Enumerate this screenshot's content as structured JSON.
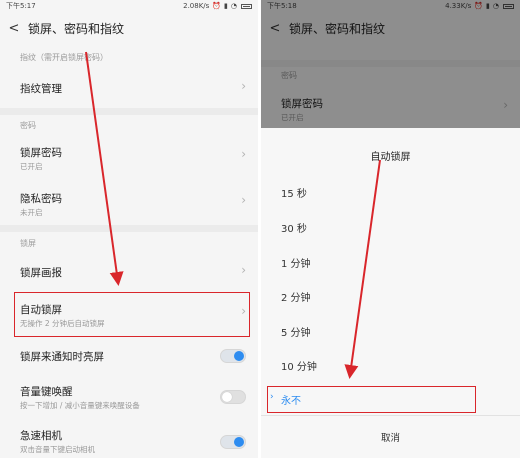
{
  "left": {
    "status": {
      "time": "下午5:17",
      "speed": "2.08K/s"
    },
    "title": "锁屏、密码和指纹",
    "fingerprint_section": "指纹（需开启锁屏密码）",
    "fingerprint_manage": "指纹管理",
    "password_section": "密码",
    "lock_password": {
      "title": "锁屏密码",
      "subtitle": "已开启"
    },
    "privacy_password": {
      "title": "隐私密码",
      "subtitle": "未开启"
    },
    "lockscreen_section": "锁屏",
    "lock_poster": "锁屏画报",
    "auto_lock": {
      "title": "自动锁屏",
      "subtitle": "无操作 2 分钟后自动锁屏"
    },
    "notify_wake": {
      "title": "锁屏来通知时亮屏",
      "on": true
    },
    "volume_wake": {
      "title": "音量键唤醒",
      "subtitle": "按一下增加 / 减小音量键来唤醒设备",
      "on": false
    },
    "quick_camera": {
      "title": "急速相机",
      "subtitle": "双击音量下键启动相机",
      "on": true
    }
  },
  "right": {
    "status": {
      "time": "下午5:18",
      "speed": "4.33K/s"
    },
    "title": "锁屏、密码和指纹",
    "password_section": "密码",
    "lock_password": {
      "title": "锁屏密码",
      "subtitle": "已开启"
    },
    "dialog": {
      "title": "自动锁屏",
      "options": [
        "15 秒",
        "30 秒",
        "1 分钟",
        "2 分钟",
        "5 分钟",
        "10 分钟",
        "永不"
      ],
      "selected": "永不",
      "cancel": "取消"
    }
  },
  "colors": {
    "accent": "#2d8cf0",
    "highlight": "#d9262b"
  }
}
